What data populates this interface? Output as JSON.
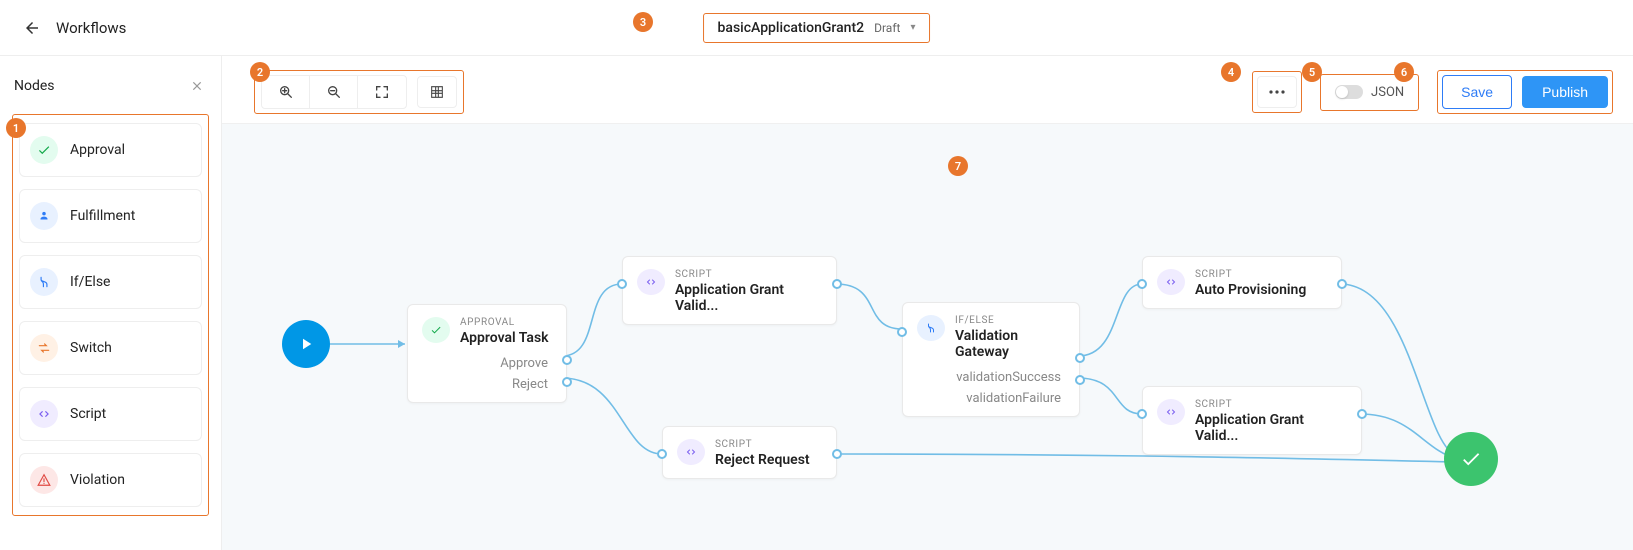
{
  "header": {
    "back_label": "Workflows",
    "workflow_name": "basicApplicationGrant2",
    "status": "Draft"
  },
  "sidebar": {
    "title": "Nodes",
    "items": [
      {
        "label": "Approval",
        "icon": "approval"
      },
      {
        "label": "Fulfillment",
        "icon": "fulfill"
      },
      {
        "label": "If/Else",
        "icon": "ifelse"
      },
      {
        "label": "Switch",
        "icon": "switch"
      },
      {
        "label": "Script",
        "icon": "script"
      },
      {
        "label": "Violation",
        "icon": "violation"
      }
    ]
  },
  "toolbar": {
    "json_label": "JSON",
    "save_label": "Save",
    "publish_label": "Publish"
  },
  "flow": {
    "approval": {
      "type": "APPROVAL",
      "title": "Approval Task",
      "out1": "Approve",
      "out2": "Reject"
    },
    "script1": {
      "type": "SCRIPT",
      "title": "Application Grant Valid..."
    },
    "script2": {
      "type": "SCRIPT",
      "title": "Reject Request"
    },
    "ifelse": {
      "type": "IF/ELSE",
      "title": "Validation Gateway",
      "out1": "validationSuccess",
      "out2": "validationFailure"
    },
    "script3": {
      "type": "SCRIPT",
      "title": "Auto Provisioning"
    },
    "script4": {
      "type": "SCRIPT",
      "title": "Application Grant Valid..."
    }
  },
  "callouts": {
    "1": "1",
    "2": "2",
    "3": "3",
    "4": "4",
    "5": "5",
    "6": "6",
    "7": "7"
  }
}
